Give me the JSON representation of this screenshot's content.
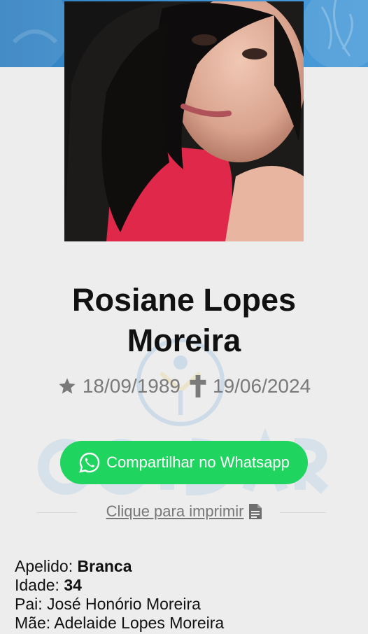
{
  "person": {
    "name": "Rosiane Lopes Moreira",
    "birth_date": "18/09/1989",
    "death_date": "19/06/2024"
  },
  "actions": {
    "share_label": "Compartilhar no Whatsapp",
    "print_label": "Clique para imprimir"
  },
  "details": {
    "nickname_label": "Apelido:",
    "nickname_value": "Branca",
    "age_label": "Idade:",
    "age_value": "34",
    "father_label": "Pai:",
    "father_value": "José Honório Moreira",
    "mother_label": "Mãe:",
    "mother_value": "Adelaide Lopes Moreira"
  },
  "colors": {
    "banner": "#3b8fd0",
    "whatsapp_green": "#1fd45f",
    "date_gray": "#7a7a7a"
  },
  "icons": {
    "birth": "star-icon",
    "death": "cross-icon",
    "share": "whatsapp-icon",
    "print": "document-icon"
  }
}
